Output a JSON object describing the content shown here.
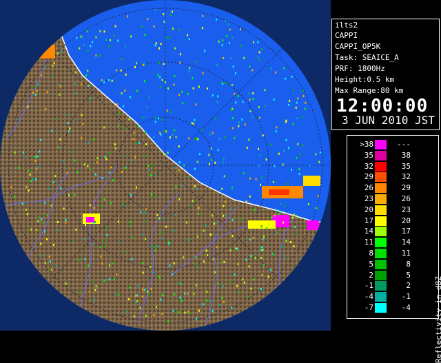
{
  "info": {
    "station": "ilts2",
    "product": "CAPPI",
    "product_name": "CAPPI_OP5K",
    "task": "Task: SEAICE_A",
    "prf": "PRF: 1800Hz",
    "height": "Height:0.5 km",
    "max_range": "Max Range:80 km",
    "time": "12:00:00",
    "date": "3 JUN 2010 JST"
  },
  "legend": {
    "unit": "Reflectivity in dBZ",
    "rows": [
      {
        "low": ">38",
        "high": "---",
        "color": "#ff00ff"
      },
      {
        "low": "35",
        "high": "38",
        "color": "#e000a0"
      },
      {
        "low": "32",
        "high": "35",
        "color": "#ff0000"
      },
      {
        "low": "29",
        "high": "32",
        "color": "#ff5000"
      },
      {
        "low": "26",
        "high": "29",
        "color": "#ff8800"
      },
      {
        "low": "23",
        "high": "26",
        "color": "#ffaa00"
      },
      {
        "low": "20",
        "high": "23",
        "color": "#ffdd00"
      },
      {
        "low": "17",
        "high": "20",
        "color": "#ffff00"
      },
      {
        "low": "14",
        "high": "17",
        "color": "#a0ff00"
      },
      {
        "low": "11",
        "high": "14",
        "color": "#00ff00"
      },
      {
        "low": "8",
        "high": "11",
        "color": "#00e000"
      },
      {
        "low": "5",
        "high": "8",
        "color": "#00c000"
      },
      {
        "low": "2",
        "high": "5",
        "color": "#00a000"
      },
      {
        "low": "-1",
        "high": "2",
        "color": "#009a60"
      },
      {
        "low": "-4",
        "high": "-1",
        "color": "#00b0a0"
      },
      {
        "low": "-7",
        "high": "-4",
        "color": "#00ffff"
      }
    ]
  },
  "colors": {
    "sea": "#1155ee",
    "land": "#7a6448",
    "coast": "#f0f0f0",
    "rivers": "#6060ff"
  }
}
